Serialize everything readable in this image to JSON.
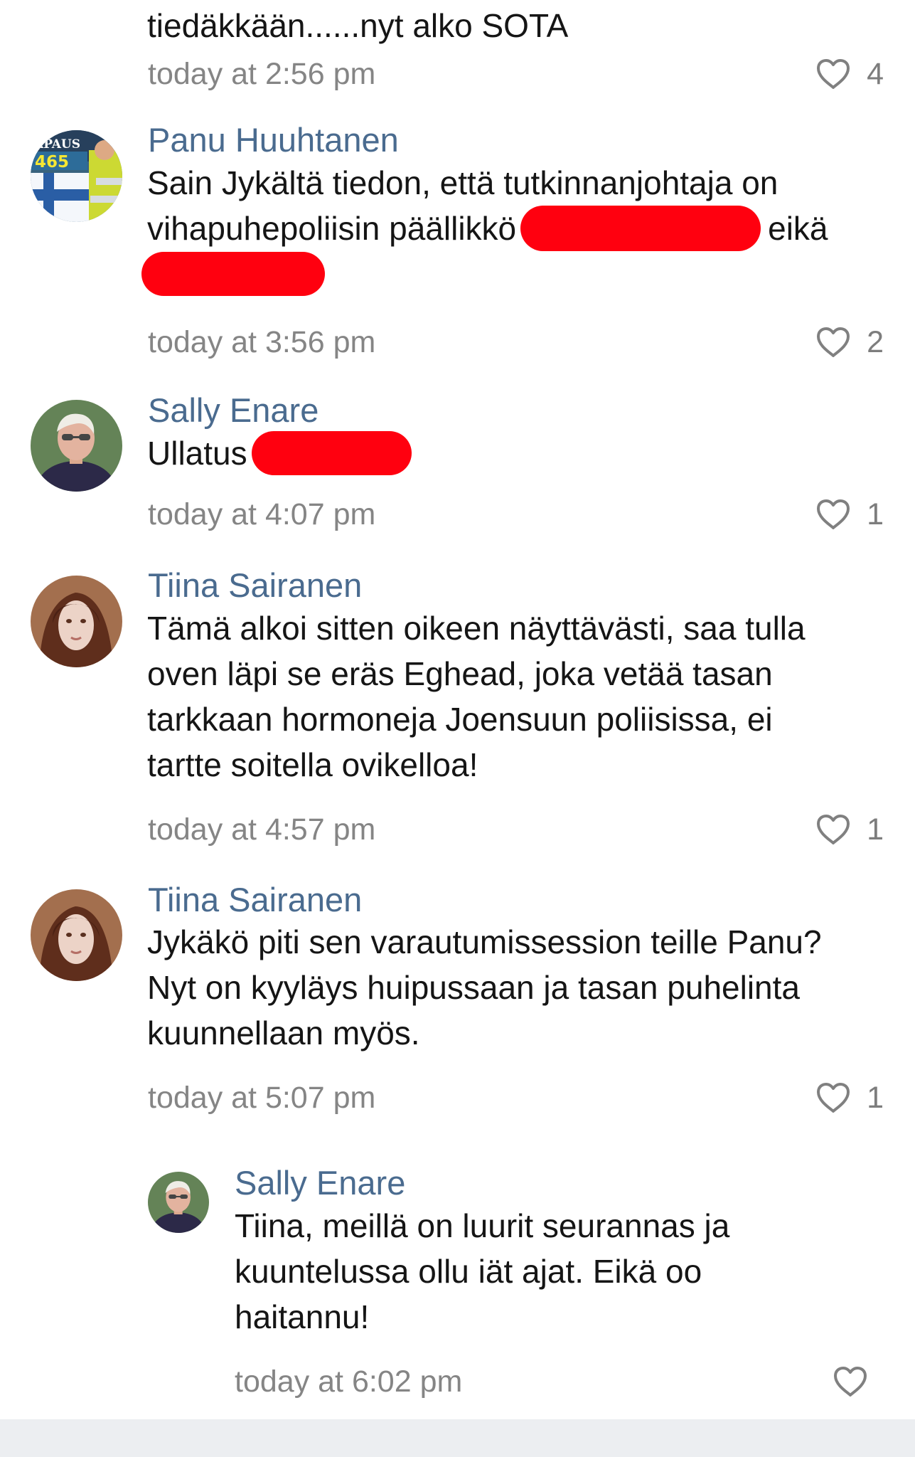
{
  "comments": [
    {
      "text_lines": [
        "tiedäkkään......nyt alko SOTA"
      ],
      "timestamp": "today at 2:56 pm",
      "like_count": "4"
    },
    {
      "author": "Panu Huuhtanen",
      "avatar_text": "APAUS 465",
      "text_lines": [
        "Sain Jykältä tiedon, että tutkinnanjohtaja on",
        "vihapuhepoliisin päällikkö",
        "eikä"
      ],
      "timestamp": "today at 3:56 pm",
      "like_count": "2"
    },
    {
      "author": "Sally Enare",
      "text_lines": [
        "Ullatus"
      ],
      "timestamp": "today at 4:07 pm",
      "like_count": "1"
    },
    {
      "author": "Tiina Sairanen",
      "text_lines": [
        "Tämä alkoi sitten oikeen näyttävästi, saa tulla",
        "oven läpi se eräs Eghead, joka vetää tasan",
        "tarkkaan hormoneja Joensuun poliisissa, ei",
        "tartte soitella ovikelloa!"
      ],
      "timestamp": "today at 4:57 pm",
      "like_count": "1"
    },
    {
      "author": "Tiina Sairanen",
      "text_lines": [
        "Jykäkö piti sen varautumissession teille Panu?",
        "Nyt on kyyläys huipussaan ja tasan puhelinta",
        "kuunnellaan myös."
      ],
      "timestamp": "today at 5:07 pm",
      "like_count": "1"
    },
    {
      "author": "Sally Enare",
      "text_lines": [
        "Tiina, meillä on luurit seurannas ja",
        "kuuntelussa ollu iät ajat. Eikä oo",
        "haitannu!"
      ],
      "timestamp": "today at 6:02 pm",
      "like_count": ""
    }
  ],
  "icons": {
    "like": "heart-outline-icon"
  },
  "colors": {
    "author_name": "#4a6b8f",
    "timestamp": "#858585",
    "redaction": "#ff000f",
    "like_icon": "#808080",
    "bottom_bar": "#eceef1"
  }
}
